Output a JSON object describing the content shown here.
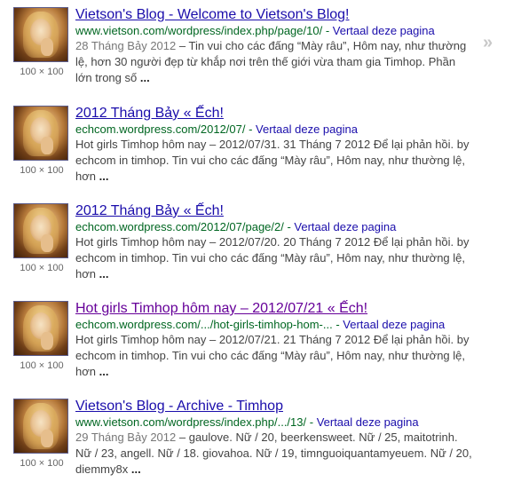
{
  "results": [
    {
      "title": "Vietson's Blog - Welcome to Vietson's Blog!",
      "url": "www.vietson.com/wordpress/index.php/page/10/",
      "cache_link": "Vertaal deze pagina",
      "date": "28 Tháng Bảy 2012",
      "snippet": "– Tin vui cho các đấng “Mày râu”, Hôm nay, như thường lệ, hơn 30 người đẹp từ khắp nơi trên thế giới vừa tham gia Timhop. Phần lớn trong số",
      "ellipsis": "...",
      "thumb_size": "100 × 100",
      "visited": false
    },
    {
      "title": "2012 Tháng Bảy « Ếch!",
      "url": "echcom.wordpress.com/2012/07/",
      "cache_link": "Vertaal deze pagina",
      "date": "",
      "snippet": "Hot girls Timhop hôm nay – 2012/07/31. 31 Tháng 7 2012 Để lại phản hồi. by echcom in timhop. Tin vui cho các đấng “Mày râu”, Hôm nay, như thường lệ, hơn",
      "ellipsis": "...",
      "thumb_size": "100 × 100",
      "visited": false
    },
    {
      "title": "2012 Tháng Bảy « Ếch!",
      "url": "echcom.wordpress.com/2012/07/page/2/",
      "cache_link": "Vertaal deze pagina",
      "date": "",
      "snippet": "Hot girls Timhop hôm nay – 2012/07/20. 20 Tháng 7 2012 Để lại phản hồi. by echcom in timhop. Tin vui cho các đấng “Mày râu”, Hôm nay, như thường lệ, hơn",
      "ellipsis": "...",
      "thumb_size": "100 × 100",
      "visited": false
    },
    {
      "title": "Hot girls Timhop hôm nay – 2012/07/21 « Ếch!",
      "url": "echcom.wordpress.com/.../hot-girls-timhop-hom-...",
      "cache_link": "Vertaal deze pagina",
      "date": "",
      "snippet": "Hot girls Timhop hôm nay – 2012/07/21. 21 Tháng 7 2012 Để lại phản hồi. by echcom in timhop. Tin vui cho các đấng “Mày râu”, Hôm nay, như thường lệ, hơn",
      "ellipsis": "...",
      "thumb_size": "100 × 100",
      "visited": true
    },
    {
      "title": "Vietson's Blog - Archive - Timhop",
      "url": "www.vietson.com/wordpress/index.php/.../13/",
      "cache_link": "Vertaal deze pagina",
      "date": "29 Tháng Bảy 2012",
      "snippet": "– gaulove. Nữ / 20, beerkensweet. Nữ / 25, maitotrinh. Nữ / 23, angell. Nữ / 18. giovahoa. Nữ / 19, timnguoiquantamyeuem. Nữ / 20, diemmy8x",
      "ellipsis": "...",
      "thumb_size": "100 × 100",
      "visited": false
    }
  ],
  "icons": {
    "more_results": "double-chevron-right-icon"
  },
  "more_glyph": "»",
  "url_separator": " - "
}
